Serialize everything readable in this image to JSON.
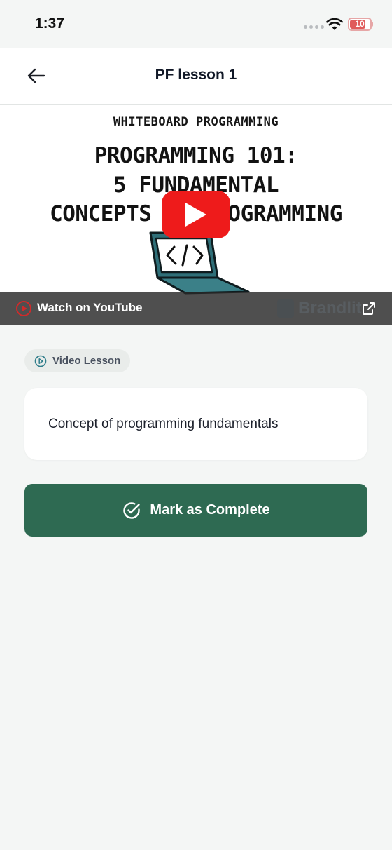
{
  "status_bar": {
    "time": "1:37",
    "battery": "10",
    "icons": [
      "signal-dots-icon",
      "wifi-icon",
      "battery-icon"
    ]
  },
  "header": {
    "title": "PF lesson 1",
    "back_icon": "arrow-left-icon"
  },
  "video": {
    "thumbnail_eyebrow": "WHITEBOARD PROGRAMMING",
    "thumbnail_title_lines": [
      "PROGRAMMING 101:",
      "5 FUNDAMENTAL",
      "CONCEPTS OF PROGRAMMING"
    ],
    "watch_label": "Watch on YouTube",
    "brand_watermark": "Brandlit",
    "play_icon": "play-icon",
    "external_icon": "external-link-icon"
  },
  "lesson": {
    "type_badge": "Video Lesson",
    "description": "Concept of programming fundamentals"
  },
  "actions": {
    "complete_label": "Mark as Complete",
    "complete_icon": "check-circle-icon"
  },
  "colors": {
    "accent": "#2e6a52",
    "background": "#f4f6f5",
    "youtube_red": "#ee1b1b"
  }
}
